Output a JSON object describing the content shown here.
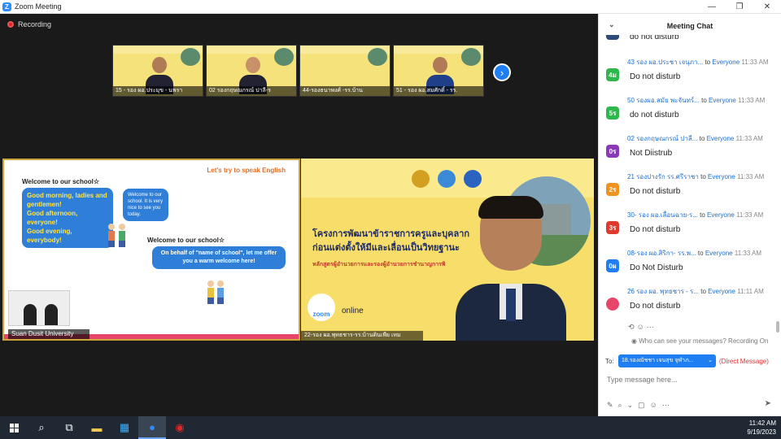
{
  "window": {
    "title": "Zoom Meeting",
    "controls": [
      "—",
      "❐",
      "✕"
    ]
  },
  "recording": {
    "label": "Recording"
  },
  "thumbnails": [
    {
      "name": "15 - รอง ผอ.ประมุข - นพรา"
    },
    {
      "name": "02 รองกฤษณกรณ์  ปาลี-ร"
    },
    {
      "name": "44-รองธนาพงศ์ -รร.บ้าน"
    },
    {
      "name": "51 - รอง ผอ.สมศักดิ์ - รร."
    }
  ],
  "shared": {
    "tag": "Let's try to speak English",
    "welcome1": "Welcome to our school☆",
    "bubble1": [
      "Good morning, ladies and",
      "gentlemen!",
      "Good afternoon, everyone!",
      "Good evening, everybody!"
    ],
    "bubble2": "Welcome to our school. It is very nice to see you today.",
    "welcome2": "Welcome to our school☆",
    "bubble3": "On behalf of \"name of school\", let me offer you a warm welcome here!",
    "user": "Suan Dusit University"
  },
  "speaker": {
    "heading1": "โครงการพัฒนาข้าราชการครูและบุคลาก",
    "heading2": "ก่อนแต่งตั้งให้มีและเลื่อนเป็นวิทยฐานะ",
    "heading3": "หลักสูตรผู้อำนวยการและรองผู้อำนวยการชำนาญการพิ",
    "zoom": "zoom",
    "online": "online",
    "user": "22-รอง ผอ.พุทธชาร-รร.บ้านดินเพีย เหม"
  },
  "chat": {
    "title": "Meeting Chat",
    "to_word": "to",
    "everyone": "Everyone",
    "messages": [
      {
        "from": "",
        "time": "",
        "avatar": "",
        "color": "#2c4a7a",
        "text": "do not disturb"
      },
      {
        "from": "43 รอง ผอ.ประชา เจนุภา...",
        "time": "11:33 AM",
        "avatar": "4ม",
        "color": "#2eb84b",
        "text": "Do not disturb"
      },
      {
        "from": "50 รองผอ.สมัย พะจันทร์...",
        "time": "11:33 AM",
        "avatar": "5ร",
        "color": "#2eb84b",
        "text": "do not disturb"
      },
      {
        "from": "02 รองกฤษณกรณ์  ปาลี...",
        "time": "11:33 AM",
        "avatar": "0ร",
        "color": "#8a3ab9",
        "text": "Not Diistrub"
      },
      {
        "from": "21 รองปางรัก รร.ศรีราชา",
        "time": "11:33 AM",
        "avatar": "2ร",
        "color": "#f0921e",
        "text": "Do not disturb"
      },
      {
        "from": "30- รอง ผอ.เลื่อนฉาย-ร...",
        "time": "11:33 AM",
        "avatar": "3ร",
        "color": "#e0392e",
        "text": "Do not disturb"
      },
      {
        "from": "08-รอง ผอ.สิริกา- รร.พ...",
        "time": "11:33 AM",
        "avatar": "0ผ",
        "color": "#1f7ff2",
        "text": "Do Not Disturb"
      },
      {
        "from": "26 รอง ผอ. พุทธชาร - ร...",
        "time": "11:11 AM",
        "avatar": "",
        "color": "#e8456a",
        "text": "Do not disturb"
      }
    ],
    "notice": "Who can see your messages? Recording On",
    "to_label": "To:",
    "to_value": "18.รองณัชชา เจนสุข จุฬาภ...",
    "direct": "(Direct Message)",
    "input_placeholder": "Type message here..."
  },
  "taskbar": {
    "time": "11:42 AM",
    "date": "9/19/2023"
  }
}
